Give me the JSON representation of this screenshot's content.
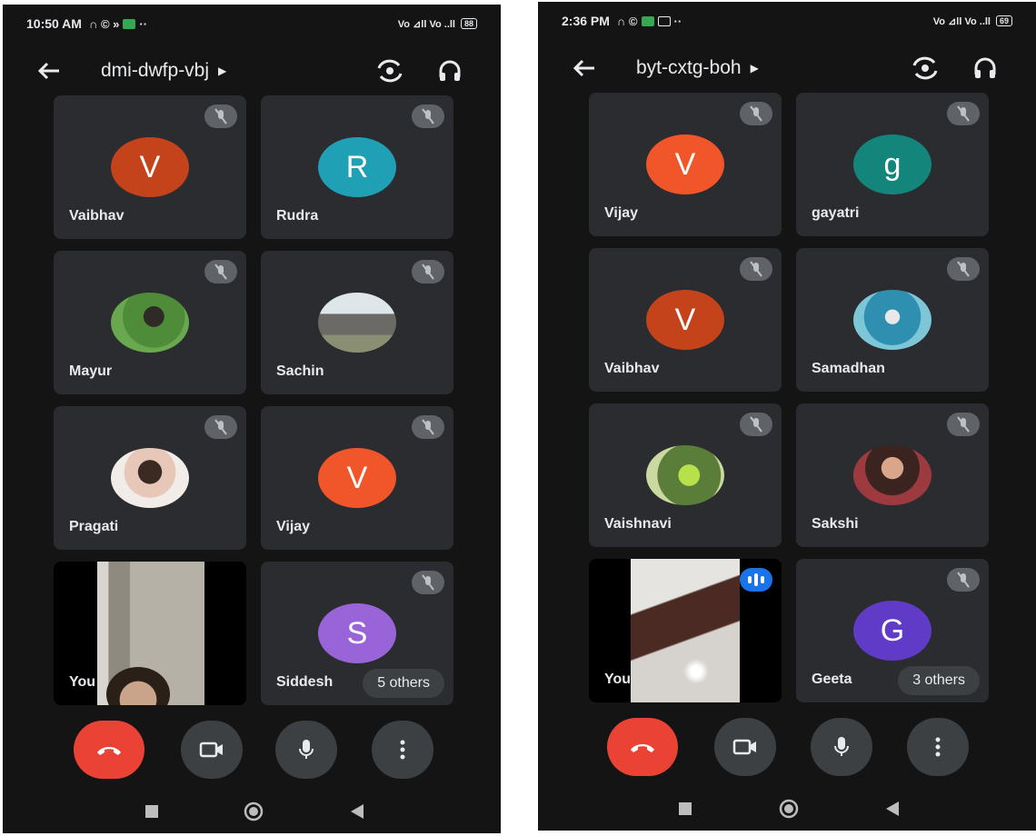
{
  "left_phone": {
    "status": {
      "time": "10:50 AM",
      "left_icons": "∩ © »",
      "right_icons": "Vo ⊿ll Vo ..ll",
      "battery": "88"
    },
    "meeting_code": "dmi-dwfp-vbj",
    "tiles": [
      {
        "name": "Vaibhav",
        "initial": "V",
        "color": "#c5431a"
      },
      {
        "name": "Rudra",
        "initial": "R",
        "color": "#1fa0b4"
      },
      {
        "name": "Mayur",
        "initial": "",
        "color": "#3f6b3a"
      },
      {
        "name": "Sachin",
        "initial": "",
        "color": "#8e9ba5"
      },
      {
        "name": "Pragati",
        "initial": "",
        "color": "#d8cfc8"
      },
      {
        "name": "Vijay",
        "initial": "V",
        "color": "#f1562a"
      },
      {
        "name": "You",
        "initial": "",
        "color": "#000000"
      },
      {
        "name": "Siddesh",
        "initial": "S",
        "color": "#9a64d9"
      }
    ],
    "others": "5 others"
  },
  "right_phone": {
    "status": {
      "time": "2:36 PM",
      "left_icons": "∩ ©",
      "right_icons": "Vo ⊿ll Vo ..ll",
      "battery": "69"
    },
    "meeting_code": "byt-cxtg-boh",
    "tiles": [
      {
        "name": "Vijay",
        "initial": "V",
        "color": "#f1562a"
      },
      {
        "name": "gayatri",
        "initial": "g",
        "color": "#13857b"
      },
      {
        "name": "Vaibhav",
        "initial": "V",
        "color": "#c5431a"
      },
      {
        "name": "Samadhan",
        "initial": "",
        "color": "#3bb2c9"
      },
      {
        "name": "Vaishnavi",
        "initial": "",
        "color": "#8bb06a"
      },
      {
        "name": "Sakshi",
        "initial": "",
        "color": "#7a3f3a"
      },
      {
        "name": "You",
        "initial": "",
        "color": "#000000"
      },
      {
        "name": "Geeta",
        "initial": "G",
        "color": "#5f3bc7"
      }
    ],
    "others": "3 others"
  }
}
